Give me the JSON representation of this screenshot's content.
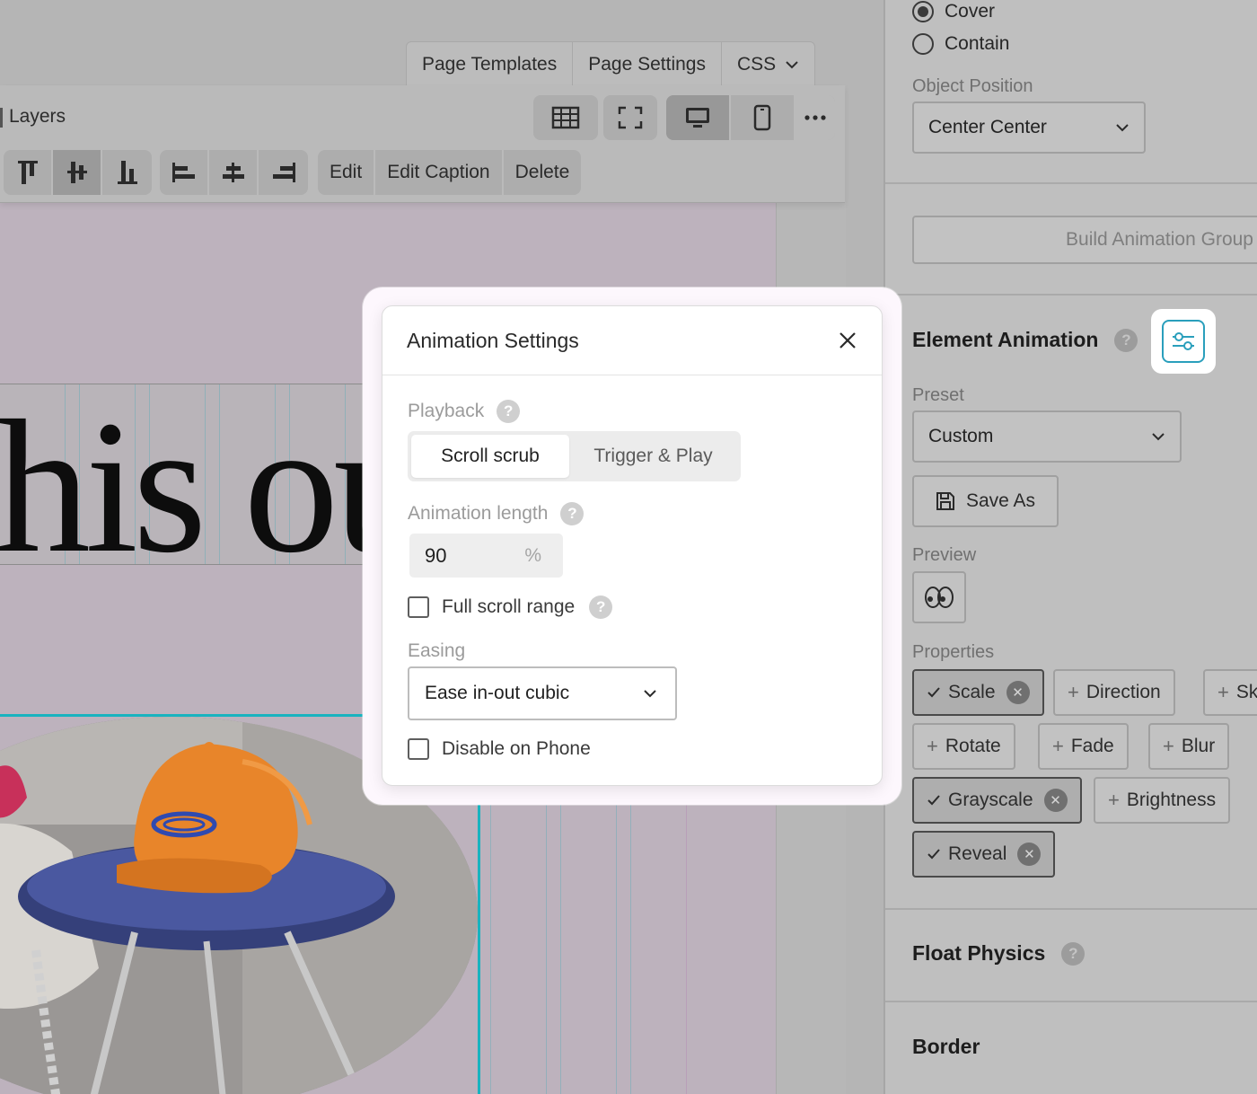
{
  "top_tabs": {
    "templates": "Page Templates",
    "settings": "Page Settings",
    "css": "CSS"
  },
  "toolbar": {
    "layers_label": "Layers",
    "views": [
      "grid-view",
      "fullscreen",
      "desktop",
      "phone",
      "more"
    ],
    "active_view": "desktop",
    "align_vertical": [
      "align-top",
      "align-middle",
      "align-bottom"
    ],
    "active_align": "align-middle",
    "align_horizontal": [
      "align-left",
      "align-center",
      "align-right"
    ],
    "edit_label": "Edit",
    "edit_caption_label": "Edit Caption",
    "delete_label": "Delete"
  },
  "canvas": {
    "heading_text": "this out"
  },
  "sidebar": {
    "fit_options": [
      {
        "label": "Cover",
        "selected": true
      },
      {
        "label": "Contain",
        "selected": false
      }
    ],
    "object_position_label": "Object Position",
    "object_position_value": "Center Center",
    "build_group_label": "Build Animation Group",
    "element_animation_title": "Element Animation",
    "preset_label": "Preset",
    "preset_value": "Custom",
    "save_as_label": "Save As",
    "preview_label": "Preview",
    "properties_label": "Properties",
    "properties": {
      "scale": "Scale",
      "direction": "Direction",
      "skew": "Sk",
      "rotate": "Rotate",
      "fade": "Fade",
      "blur": "Blur",
      "grayscale": "Grayscale",
      "brightness": "Brightness",
      "reveal": "Reveal"
    },
    "active_properties": [
      "Scale",
      "Grayscale",
      "Reveal"
    ],
    "float_physics_title": "Float Physics",
    "border_title": "Border",
    "help_glyph": "?"
  },
  "modal": {
    "title": "Animation Settings",
    "playback_label": "Playback",
    "playback_options": [
      "Scroll scrub",
      "Trigger & Play"
    ],
    "playback_selected": "Scroll scrub",
    "animation_length_label": "Animation length",
    "animation_length_value": "90",
    "animation_length_unit": "%",
    "full_scroll_label": "Full scroll range",
    "full_scroll_checked": false,
    "easing_label": "Easing",
    "easing_value": "Ease in-out cubic",
    "disable_phone_label": "Disable on Phone",
    "disable_phone_checked": false,
    "help_glyph": "?"
  },
  "colors": {
    "accent": "#2a9fbc",
    "guide_cyan": "#18b3bf",
    "overlay_gray": "#b5b5b5",
    "cap_orange": "#e8852a"
  }
}
